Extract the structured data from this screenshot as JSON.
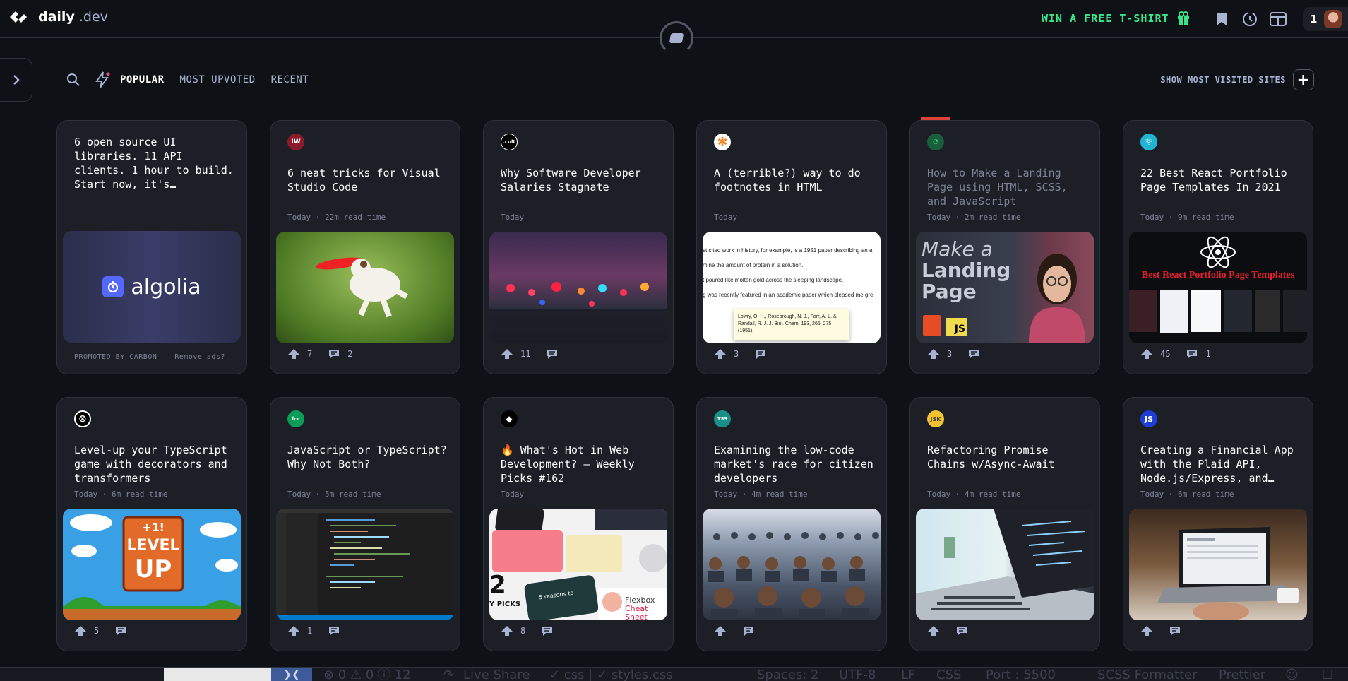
{
  "header": {
    "logo_name": "daily",
    "logo_suffix": ".dev",
    "promo_label": "WIN A FREE T-SHIRT",
    "reputation": "1",
    "icons": [
      "bookmark-icon",
      "history-icon",
      "layout-icon"
    ]
  },
  "feed_nav": {
    "tabs": [
      {
        "label": "POPULAR",
        "active": true
      },
      {
        "label": "MOST UPVOTED",
        "active": false
      },
      {
        "label": "RECENT",
        "active": false
      }
    ],
    "most_visited_label": "SHOW MOST VISITED SITES"
  },
  "promo_card": {
    "text": "6 open source UI libraries. 11 API clients. 1 hour to build. Start now, it's…",
    "image_brand": "algolia",
    "footer_left": "PROMOTED BY CARBON",
    "footer_right": "Remove ads?"
  },
  "cards": [
    {
      "source": "IW",
      "source_color": "#8b1a2b",
      "title": "6 neat tricks for Visual Studio Code",
      "meta": "Today · 22m read time",
      "upvotes": "7",
      "comments": "2",
      "image": "frisbee dog"
    },
    {
      "source": ".cult",
      "source_color": "#000000",
      "title": "Why Software Developer Salaries Stagnate",
      "meta": "Today",
      "upvotes": "11",
      "comments": "",
      "image": "traffic lights"
    },
    {
      "source": "✱",
      "source_color": "#f08c2e",
      "title": "A (terrible?) way to do footnotes in HTML",
      "meta": "Today",
      "upvotes": "3",
      "comments": "",
      "image": "footnotes"
    },
    {
      "source": "◔",
      "source_color": "#1b5e3a",
      "title": "How to Make a Landing Page using HTML, SCSS, and JavaScript",
      "meta": "Today · 2m read time",
      "upvotes": "3",
      "comments": "",
      "image": "landing page"
    },
    {
      "source": "⚛",
      "source_color": "#1fb4d2",
      "title": "22 Best React Portfolio Page Templates In 2021",
      "meta": "Today · 9m read time",
      "upvotes": "45",
      "comments": "1",
      "image": "react templates"
    },
    {
      "source": "⊗",
      "source_color": "#000000",
      "title": "Level-up your TypeScript game with decorators and transformers",
      "meta": "Today · 6m read time",
      "upvotes": "5",
      "comments": "",
      "image": "level up"
    },
    {
      "source": "fcc",
      "source_color": "#0a9d58",
      "title": "JavaScript or TypeScript? Why Not Both?",
      "meta": "Today · 5m read time",
      "upvotes": "1",
      "comments": "",
      "image": "code editor"
    },
    {
      "source": "◆",
      "source_color": "#000000",
      "title": "🔥 What's Hot in Web Development? — Weekly Picks #162",
      "meta": "Today",
      "upvotes": "8",
      "comments": "",
      "image": "weekly picks"
    },
    {
      "source": "TSS",
      "source_color": "#1a8f86",
      "title": "Examining the low-code market's race for citizen developers",
      "meta": "Today · 4m read time",
      "upvotes": "",
      "comments": "",
      "image": "crowd"
    },
    {
      "source": "JSK",
      "source_color": "#f2c230",
      "title": "Refactoring Promise Chains w/Async-Await",
      "meta": "Today · 4m read time",
      "upvotes": "",
      "comments": "",
      "image": "laptop"
    },
    {
      "source": "JS",
      "source_color": "#1e3cd6",
      "title": "Creating a Financial App with the Plaid API, Node.js/Express, and…",
      "meta": "Today · 6m read time",
      "upvotes": "",
      "comments": "",
      "image": "laptop hands"
    }
  ],
  "image_text": {
    "landing_line1": "Make a",
    "landing_line2": "Landing",
    "landing_line3": "Page",
    "react_heading": "Best React Portfolio Page Templates",
    "levelup_line1": "+1!",
    "levelup_line2": "LEVEL",
    "levelup_line3": "UP",
    "weekly_big": "2",
    "weekly_picks": "Y PICKS",
    "weekly_flexbox": "Flexbox",
    "weekly_cheat": "Cheat Sheet",
    "weekly_reasons": "5 reasons to",
    "footnote_lines": [
      "st cited work in history, for example, is a 1951 paper  describing an a",
      "mine the amount of protein in a solution.",
      "t poured like molten gold    across the sleeping landscape.",
      "g was recently featured in an academic paper     which pleased me gre"
    ],
    "footnote_box": "Lowry, O. H., Rosebrough, N. J., Farr, A. L. & Randall, R. J. J. Biol. Chem. 193, 265–275 (1951)."
  },
  "status_bar": {
    "problems": "⊗ 0 ⚠ 0 ⓘ 12",
    "live_share": "Live Share",
    "css_file": "✓ css | ✓ styles.css",
    "spaces": "Spaces: 2",
    "encoding": "UTF-8",
    "eol": "LF",
    "language": "CSS",
    "port": "Port : 5500",
    "formatter": "SCSS Formatter",
    "prettier": "Prettier"
  }
}
